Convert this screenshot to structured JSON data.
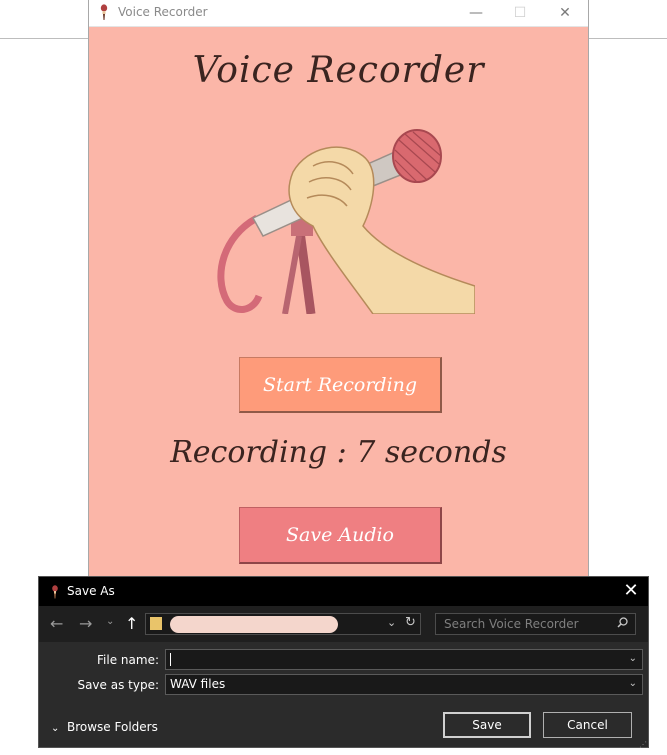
{
  "recorder_window": {
    "title": "Voice Recorder",
    "heading": "Voice Recorder",
    "start_button": "Start Recording",
    "status": "Recording : 7 seconds",
    "save_button": "Save Audio",
    "controls": {
      "minimize": "—",
      "maximize": "☐",
      "close": "✕"
    }
  },
  "save_dialog": {
    "title": "Save As",
    "close_glyph": "✕",
    "nav": {
      "back": "←",
      "forward": "→",
      "dropdown": "⌄",
      "up": "↑"
    },
    "address_path": "",
    "search_placeholder": "Search Voice Recorder",
    "file_name_label": "File name:",
    "file_name_value": "",
    "save_type_label": "Save as type:",
    "save_type_value": "WAV files",
    "browse_folders": "Browse Folders",
    "save_button": "Save",
    "cancel_button": "Cancel"
  },
  "colors": {
    "window_bg": "#fbb6a8",
    "start_button_bg": "#fe9b7a",
    "save_audio_bg": "#ef7f82",
    "heading_text": "#3a2420",
    "dialog_bg": "#2b2b2b"
  }
}
